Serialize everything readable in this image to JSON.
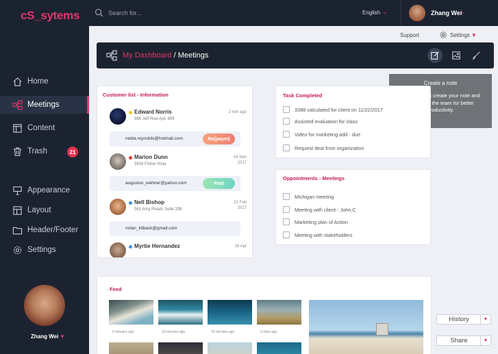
{
  "app": {
    "logo": "cS_sytems"
  },
  "sidebar": {
    "items": [
      {
        "label": "Home",
        "icon": "home-icon"
      },
      {
        "label": "Meetings",
        "icon": "meetings-icon"
      },
      {
        "label": "Content",
        "icon": "content-icon"
      },
      {
        "label": "Trash",
        "icon": "trash-icon",
        "badge": "21"
      },
      {
        "label": "Appearance",
        "icon": "appearance-icon"
      },
      {
        "label": "Layout",
        "icon": "layout-icon"
      },
      {
        "label": "Header/Footer",
        "icon": "folder-icon"
      },
      {
        "label": "Settings",
        "icon": "gear-icon"
      }
    ],
    "active": "Meetings",
    "user_name": "Zhang Wei"
  },
  "topbar": {
    "search_placeholder": "Search for...",
    "language": "English",
    "user_name": "Zhang Wei"
  },
  "subbar": {
    "support": "Support",
    "settings": "Settings"
  },
  "breadcrumb": {
    "link": "My Dashboard",
    "separator": " / ",
    "current": "Meetings"
  },
  "tooltip": {
    "title": "Create a note",
    "body": "Here you can create your note and share with the team for better productivity."
  },
  "customers": {
    "title": "Customer list - Information",
    "rows": [
      {
        "name": "Edward Norris",
        "address": "986 Jeff Row Apt. 809",
        "time": "2 min ago",
        "email": "nelda.reynolds@hotmail.com",
        "status": "No(paym)",
        "dot": "#f5c518"
      },
      {
        "name": "Marion Dunn",
        "address": "3504 Fisher Vista",
        "time": "04 Nov 2017",
        "email": "augustus_wehner@yahoo.com",
        "status": "Paid",
        "dot": "#e53935"
      },
      {
        "name": "Nell Bishop",
        "address": "061 Amy Roads Suite 338",
        "time": "22 Feb 2017",
        "email": "nolan_kilback@gmail.com",
        "status": "",
        "dot": "#3d8fe0"
      },
      {
        "name": "Myrtie Hernandez",
        "address": "",
        "time": "16 Apr",
        "email": "",
        "status": "",
        "dot": "#3d8fe0"
      }
    ]
  },
  "tasks": {
    "title": "Task Completed",
    "items": [
      "3388 calculated for client on 11/22/2017",
      "Assisted evaluation for class",
      "Video for marketing add - due",
      "Request deal from organization"
    ]
  },
  "meetings": {
    "title": "Oppointments - Meetings",
    "items": [
      "Michigan meeting",
      "Meeting with client - John.C",
      "Marketing plan of Action",
      "Meeting with stakeholders"
    ]
  },
  "feed": {
    "title": "Feed",
    "times": [
      "5 minutes ago",
      "10 minutes ago",
      "23 minutes ago",
      "2 days ago"
    ]
  },
  "buttons": {
    "history": "History",
    "share": "Share"
  },
  "colors": {
    "accent": "#e0356b",
    "sidebar": "#1c2330",
    "badge": "#e0334f"
  }
}
